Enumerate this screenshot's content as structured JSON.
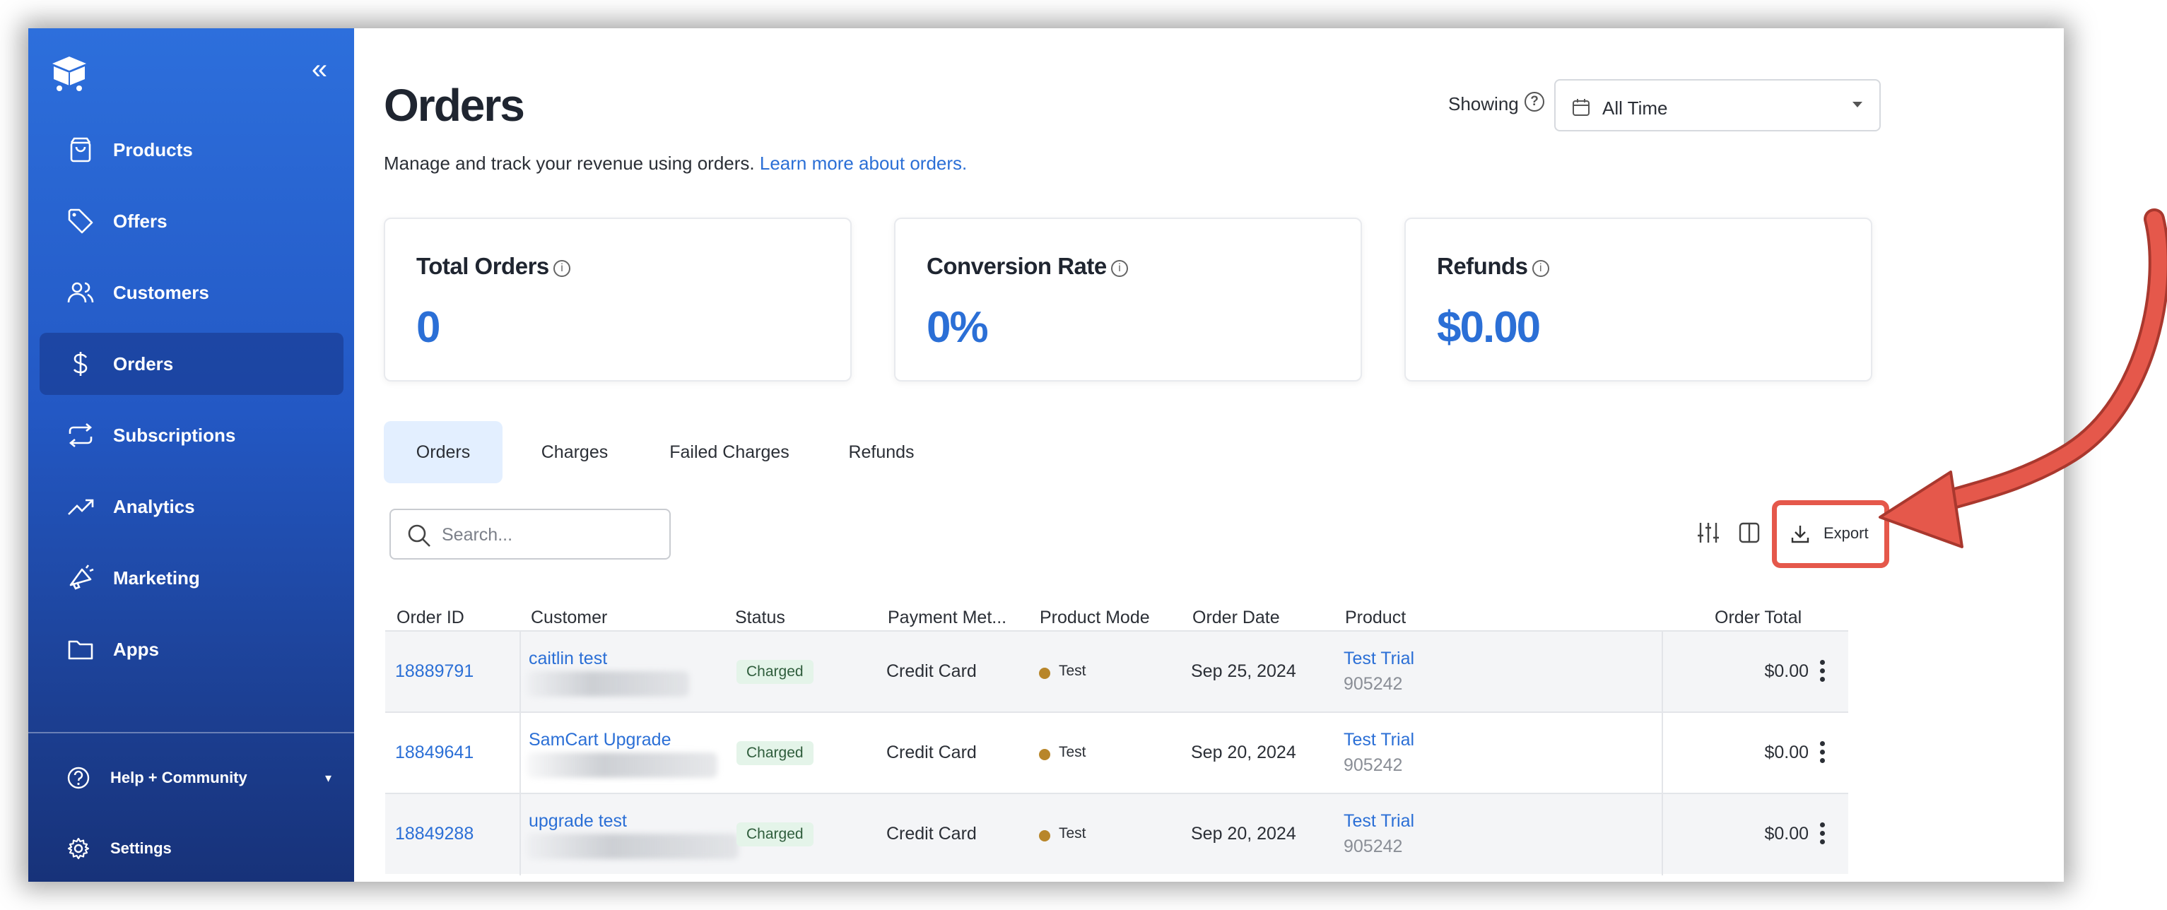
{
  "colors": {
    "sidebar_top": "#2d6fdc",
    "sidebar_bottom": "#173279",
    "accent": "#2b6fd6",
    "annotation": "#e5584b",
    "badge_bg": "#e4f4e9",
    "test_dot": "#b8862a"
  },
  "sidebar": {
    "collapse_icon": "double-chevron-left-icon",
    "items": [
      {
        "label": "Products",
        "icon": "shopping-bag-icon"
      },
      {
        "label": "Offers",
        "icon": "tag-icon"
      },
      {
        "label": "Customers",
        "icon": "users-icon"
      },
      {
        "label": "Orders",
        "icon": "dollar-icon",
        "active": true
      },
      {
        "label": "Subscriptions",
        "icon": "repeat-icon"
      },
      {
        "label": "Analytics",
        "icon": "trending-up-icon"
      },
      {
        "label": "Marketing",
        "icon": "megaphone-icon"
      },
      {
        "label": "Apps",
        "icon": "folder-icon"
      }
    ],
    "help_label": "Help + Community",
    "settings_label": "Settings"
  },
  "header": {
    "title": "Orders",
    "description": "Manage and track your revenue using orders.",
    "learn_more": "Learn more about orders.",
    "showing_label": "Showing",
    "time_filter": "All Time"
  },
  "stats": [
    {
      "title": "Total Orders",
      "value": "0"
    },
    {
      "title": "Conversion Rate",
      "value": "0%"
    },
    {
      "title": "Refunds",
      "value": "$0.00"
    }
  ],
  "tabs": [
    "Orders",
    "Charges",
    "Failed Charges",
    "Refunds"
  ],
  "search": {
    "placeholder": "Search..."
  },
  "toolbar": {
    "export_label": "Export"
  },
  "table": {
    "columns": [
      "Order ID",
      "Customer",
      "Status",
      "Payment Met...",
      "Product Mode",
      "Order Date",
      "Product",
      "Order Total"
    ],
    "rows": [
      {
        "order_id": "18889791",
        "customer": "caitlin test",
        "status": "Charged",
        "payment": "Credit Card",
        "mode": "Test",
        "date": "Sep 25, 2024",
        "product": "Test Trial",
        "product_id": "905242",
        "total": "$0.00"
      },
      {
        "order_id": "18849641",
        "customer": "SamCart Upgrade",
        "status": "Charged",
        "payment": "Credit Card",
        "mode": "Test",
        "date": "Sep 20, 2024",
        "product": "Test Trial",
        "product_id": "905242",
        "total": "$0.00"
      },
      {
        "order_id": "18849288",
        "customer": "upgrade test",
        "status": "Charged",
        "payment": "Credit Card",
        "mode": "Test",
        "date": "Sep 20, 2024",
        "product": "Test Trial",
        "product_id": "905242",
        "total": "$0.00"
      }
    ]
  }
}
